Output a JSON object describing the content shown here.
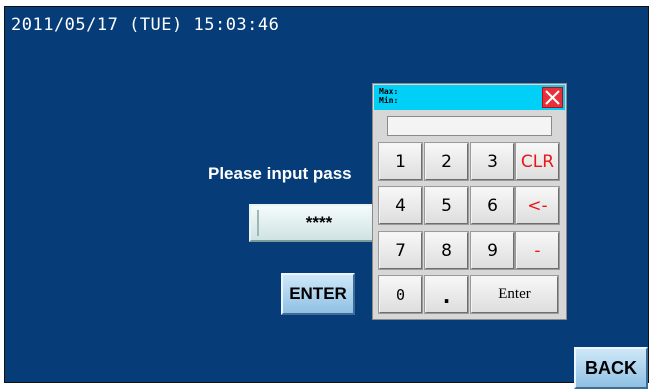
{
  "status_bar": {
    "datetime": "2011/05/17 (TUE) 15:03:46"
  },
  "login": {
    "prompt": "Please input pass",
    "password_value": "****",
    "enter_label": "ENTER"
  },
  "nav": {
    "back_label": "BACK"
  },
  "keypad": {
    "max_label": "Max:",
    "min_label": "Min:",
    "display_value": "",
    "close_icon": "close-x-icon",
    "rows": [
      [
        {
          "label": "1"
        },
        {
          "label": "2"
        },
        {
          "label": "3"
        },
        {
          "label": "CLR"
        }
      ],
      [
        {
          "label": "4"
        },
        {
          "label": "5"
        },
        {
          "label": "6"
        },
        {
          "label": "<-"
        }
      ],
      [
        {
          "label": "7"
        },
        {
          "label": "8"
        },
        {
          "label": "9"
        },
        {
          "label": "-"
        }
      ],
      [
        {
          "label": "0"
        },
        {
          "label": "."
        },
        {
          "label": "Enter"
        }
      ]
    ]
  },
  "colors": {
    "background": "#063c78",
    "titlebar": "#00d0f8",
    "close": "#e8303a",
    "function_key_text": "#e81818",
    "button_face": "#8fc0e4"
  }
}
